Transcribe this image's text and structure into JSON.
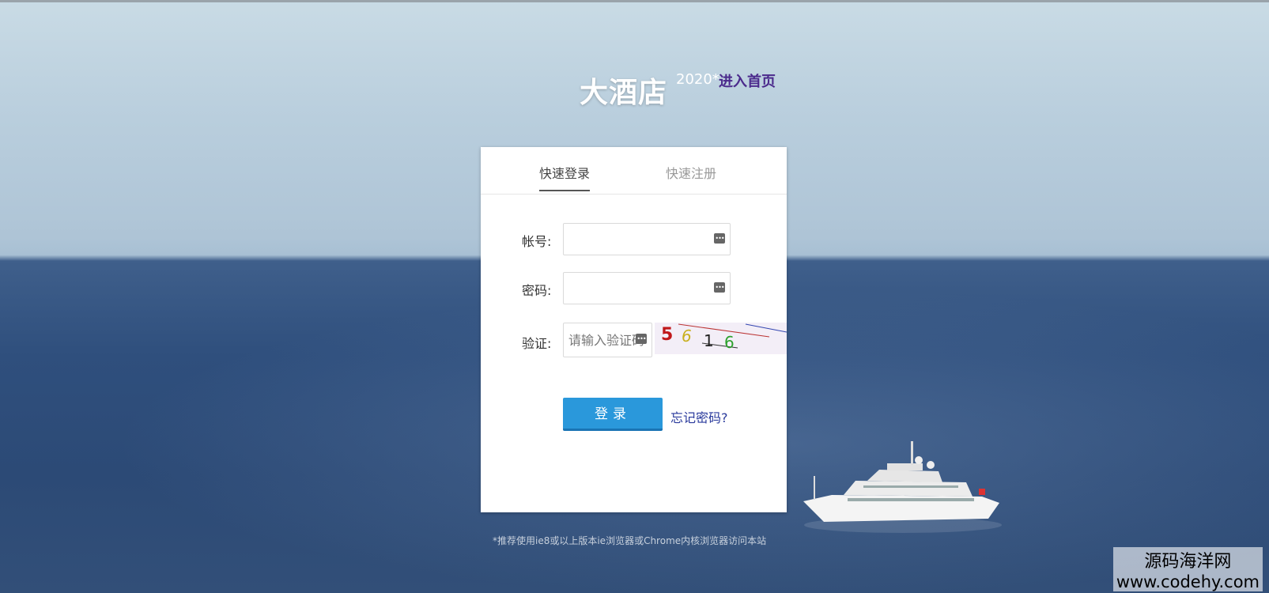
{
  "brand": {
    "title": "大酒店",
    "year": "2020*",
    "link_label": "进入首页"
  },
  "tabs": [
    {
      "label": "快速登录",
      "active": true
    },
    {
      "label": "快速注册",
      "active": false
    }
  ],
  "form": {
    "account_label": "帐号:",
    "account_value": "",
    "password_label": "密码:",
    "password_value": "",
    "captcha_label": "验证:",
    "captcha_placeholder": "请输入验证码",
    "captcha_chars": [
      "5",
      "6",
      "1",
      "6"
    ],
    "login_button": "登录",
    "forgot_link": "忘记密码?"
  },
  "notice": "*推荐使用ie8或以上版本ie浏览器或Chrome内核浏览器访问本站",
  "watermark": {
    "line1": "源码海洋网",
    "line2": "www.codehy.com"
  },
  "colors": {
    "button": "#2a98db",
    "link": "#4b2a8c"
  }
}
